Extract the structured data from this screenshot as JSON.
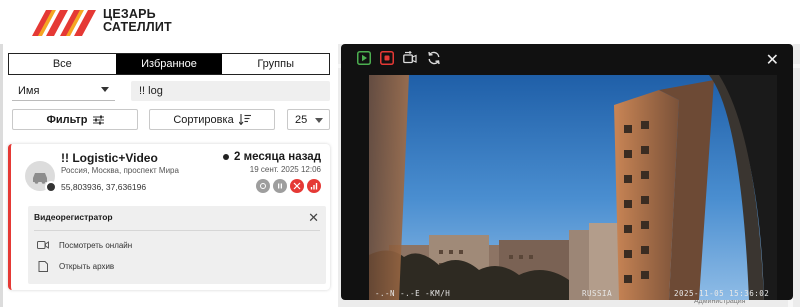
{
  "brand": {
    "line1": "ЦЕЗАРЬ",
    "line2": "САТЕЛЛИТ"
  },
  "tabs": [
    {
      "label": "Все",
      "active": false
    },
    {
      "label": "Избранное",
      "active": true
    },
    {
      "label": "Группы",
      "active": false
    }
  ],
  "filters": {
    "name_select": "Имя",
    "search_value": "!! log",
    "filter_label": "Фильтр",
    "sort_label": "Сортировка",
    "page_size": "25"
  },
  "object": {
    "name": "!! Logistic+Video",
    "address": "Россия, Москва, проспект Мира",
    "coords": "55,803936, 37,636196",
    "last_seen": "2 месяца назад",
    "date": "19 сент. 2025 12:06",
    "status_colors": {
      "grey": "#9e9e9e",
      "red": "#e53935"
    }
  },
  "dvr_panel": {
    "title": "Видеорегистратор",
    "watch_online": "Посмотреть онлайн",
    "open_archive": "Открыть архив"
  },
  "video": {
    "osd_left": "-.-N -.-E -KM/H",
    "osd_country": "RUSSIA",
    "osd_timestamp": "2025-11-05 15:36:02"
  },
  "map": {
    "label_admin": "Администрация"
  },
  "colors": {
    "accent": "#e53935",
    "tool_green": "#4caf50",
    "tool_red": "#e53935"
  }
}
